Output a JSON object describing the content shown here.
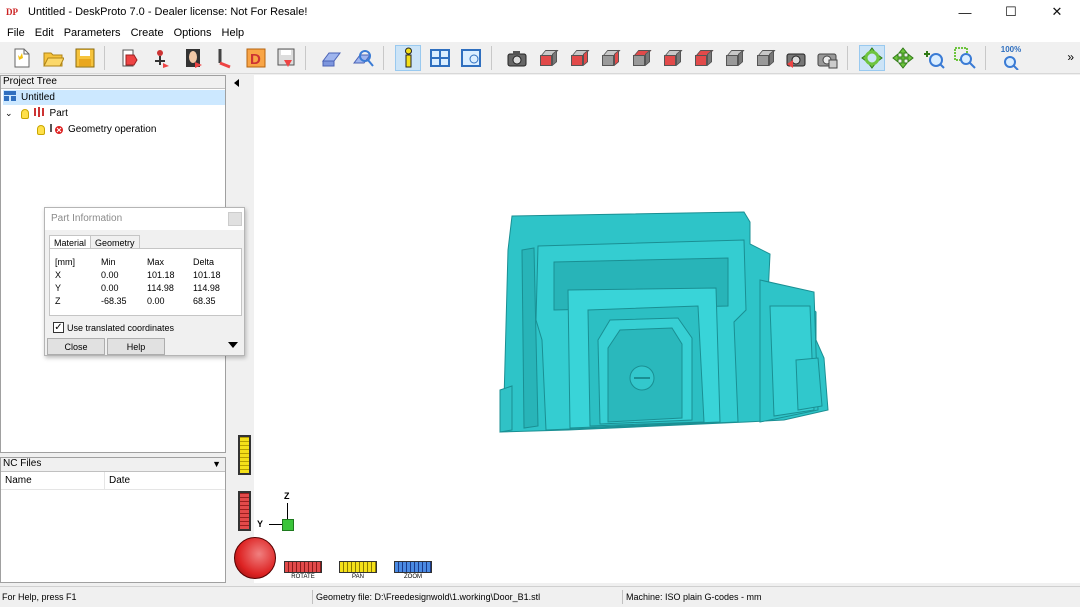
{
  "window": {
    "title": "Untitled - DeskProto 7.0 - Dealer license: Not For Resale!",
    "app_icon_text": "DP"
  },
  "menu": [
    "File",
    "Edit",
    "Parameters",
    "Create",
    "Options",
    "Help"
  ],
  "toolbar": {
    "zoom_label": "100%",
    "buttons": [
      "new",
      "open",
      "save",
      "import-geometry",
      "import-vector",
      "import-bitmap",
      "create-part",
      "create-operation",
      "save-nc",
      "flip",
      "part-info-search",
      "info",
      "layout",
      "view-screen",
      "camera",
      "view-front",
      "view-back",
      "view-left",
      "view-right",
      "view-top",
      "view-bottom",
      "view-iso",
      "view-iso-2",
      "snapshot",
      "print-screen",
      "rotate",
      "pan",
      "zoom-in",
      "zoom-window",
      "zoom-100"
    ]
  },
  "project_tree": {
    "header": "Project Tree",
    "items": [
      {
        "label": "Untitled",
        "level": 0,
        "selected": true
      },
      {
        "label": "Part",
        "level": 1,
        "selected": false
      },
      {
        "label": "Geometry operation",
        "level": 2,
        "selected": false
      }
    ]
  },
  "nc_files": {
    "header": "NC Files",
    "columns": [
      "Name",
      "Date"
    ]
  },
  "part_info": {
    "title": "Part Information",
    "tabs": [
      "Material",
      "Geometry"
    ],
    "active_tab": "Material",
    "table": {
      "header": [
        "[mm]",
        "Min",
        "Max",
        "Delta"
      ],
      "rows": [
        [
          "X",
          "0.00",
          "101.18",
          "101.18"
        ],
        [
          "Y",
          "0.00",
          "114.98",
          "114.98"
        ],
        [
          "Z",
          "-68.35",
          "0.00",
          "68.35"
        ]
      ]
    },
    "checkbox_label": "Use translated coordinates",
    "checkbox_checked": true,
    "close_label": "Close",
    "help_label": "Help"
  },
  "viewport": {
    "model_color": "#2ec4c8",
    "axis_z": "Z",
    "axis_y": "Y",
    "nav": {
      "rotate": "ROTATE",
      "pan": "PAN",
      "zoom": "ZOOM"
    }
  },
  "status": {
    "help": "For Help, press F1",
    "geometry_file": "Geometry file: D:\\Freedesignwold\\1.working\\Door_B1.stl",
    "machine": "Machine: ISO plain G-codes - mm"
  }
}
